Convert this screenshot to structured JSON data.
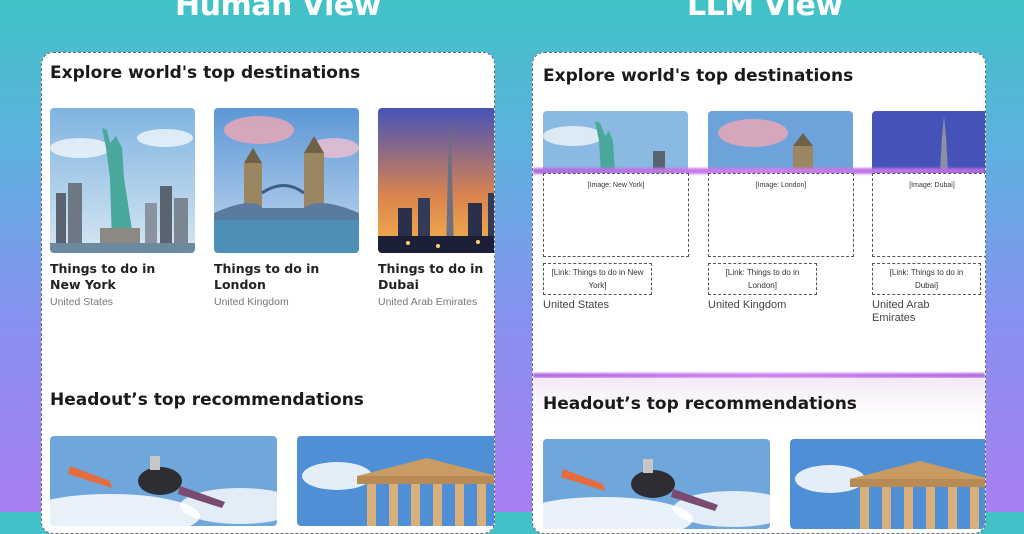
{
  "headings": {
    "left": "Human View",
    "right": "LLM View"
  },
  "human": {
    "section1_title": "Explore world's top destinations",
    "cards": [
      {
        "title": "Things to do in New York",
        "country": "United States"
      },
      {
        "title": "Things to do in London",
        "country": "United Kingdom"
      },
      {
        "title": "Things to do in Dubai",
        "country": "United Arab Emirates"
      }
    ],
    "section2_title": "Headout’s top recommendations"
  },
  "llm": {
    "section1_title": "Explore world's top destinations",
    "cards": [
      {
        "image_label": "[Image: New York]",
        "link_label": "[Link: Things to do in New York]",
        "country": "United States"
      },
      {
        "image_label": "[Image: London]",
        "link_label": "[Link: Things to do in London]",
        "country": "United Kingdom"
      },
      {
        "image_label": "[Image: Dubai]",
        "link_label": "[Link: Things to do in Dubai]",
        "country": "United Arab Emirates"
      }
    ],
    "section2_title": "Headout’s top recommendations"
  }
}
